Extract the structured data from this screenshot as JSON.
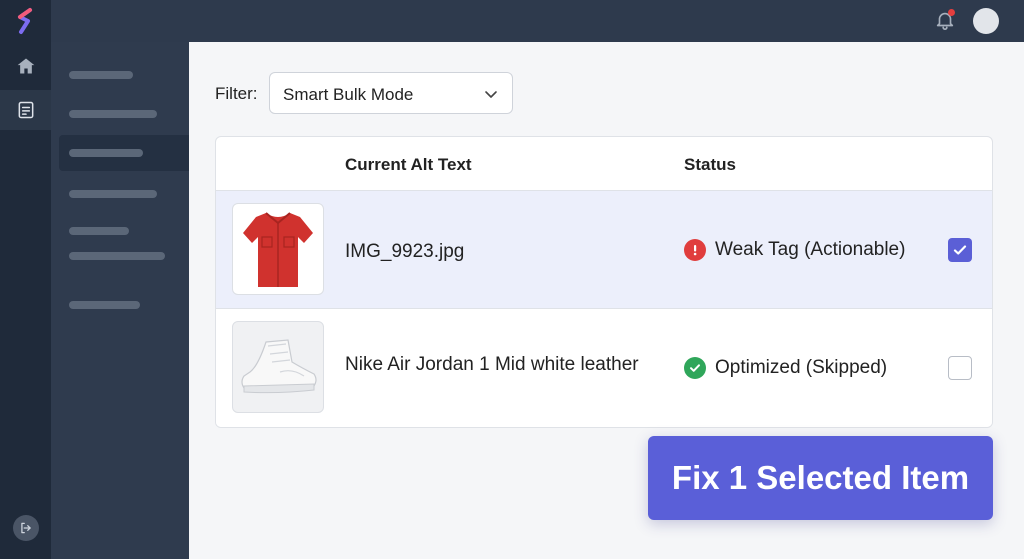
{
  "sidebar": {
    "items": [
      {
        "icon": "home-icon"
      },
      {
        "icon": "document-list-icon",
        "active": true
      }
    ],
    "logout_icon": "logout-icon"
  },
  "header": {
    "notification_icon": "bell-icon",
    "has_unread": true,
    "avatar": "user-avatar"
  },
  "filter": {
    "label": "Filter:",
    "selected": "Smart Bulk Mode"
  },
  "table": {
    "columns": [
      "",
      "Current Alt Text",
      "Status",
      ""
    ],
    "rows": [
      {
        "image": "red-shirt",
        "alt_text": "IMG_9923.jpg",
        "status": "Weak Tag (Actionable)",
        "status_type": "error",
        "selected": true
      },
      {
        "image": "white-sneaker",
        "alt_text": "Nike Air Jordan 1 Mid white leather",
        "status": "Optimized (Skipped)",
        "status_type": "success",
        "selected": false
      }
    ]
  },
  "action": {
    "label": "Fix 1 Selected Item"
  },
  "colors": {
    "accent": "#5a5fd8",
    "error": "#e03d3d",
    "success": "#2fa65a",
    "selected_row": "#eceffb"
  }
}
